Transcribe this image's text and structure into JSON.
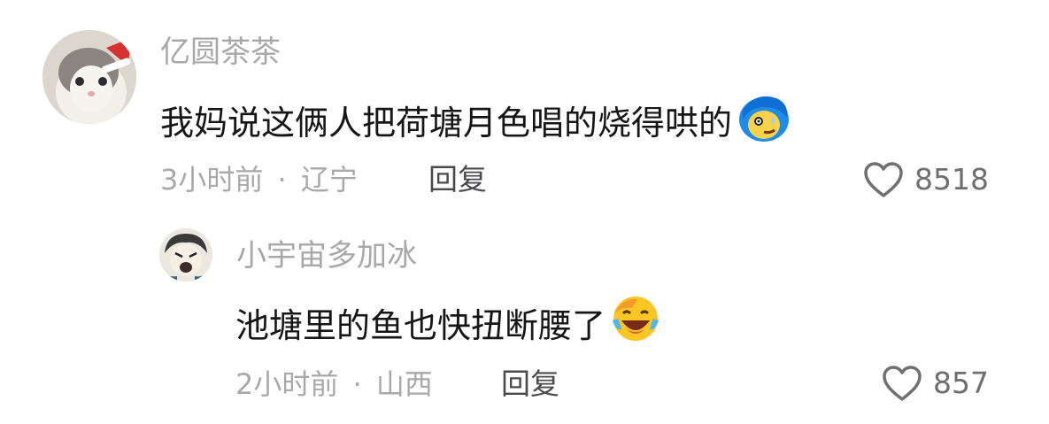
{
  "comments": [
    {
      "username": "亿圆茶茶",
      "text": "我妈说这俩人把荷塘月色唱的烧得哄的",
      "emoji": "blue-hair-sweat-emoji",
      "time": "3小时前",
      "location": "辽宁",
      "separator": "·",
      "reply_label": "回复",
      "likes": "8518",
      "avatar": "cat-with-santa-hat-avatar"
    },
    {
      "username": "小宇宙多加冰",
      "text": "池塘里的鱼也快扭断腰了",
      "emoji": "laughing-crying-emoji",
      "time": "2小时前",
      "location": "山西",
      "separator": "·",
      "reply_label": "回复",
      "likes": "857",
      "avatar": "cartoon-character-avatar"
    }
  ],
  "colors": {
    "username": "#a8a8ab",
    "text": "#161616",
    "meta": "#a9a9ac",
    "reply": "#4a4a4e",
    "like": "#6f6f73"
  }
}
